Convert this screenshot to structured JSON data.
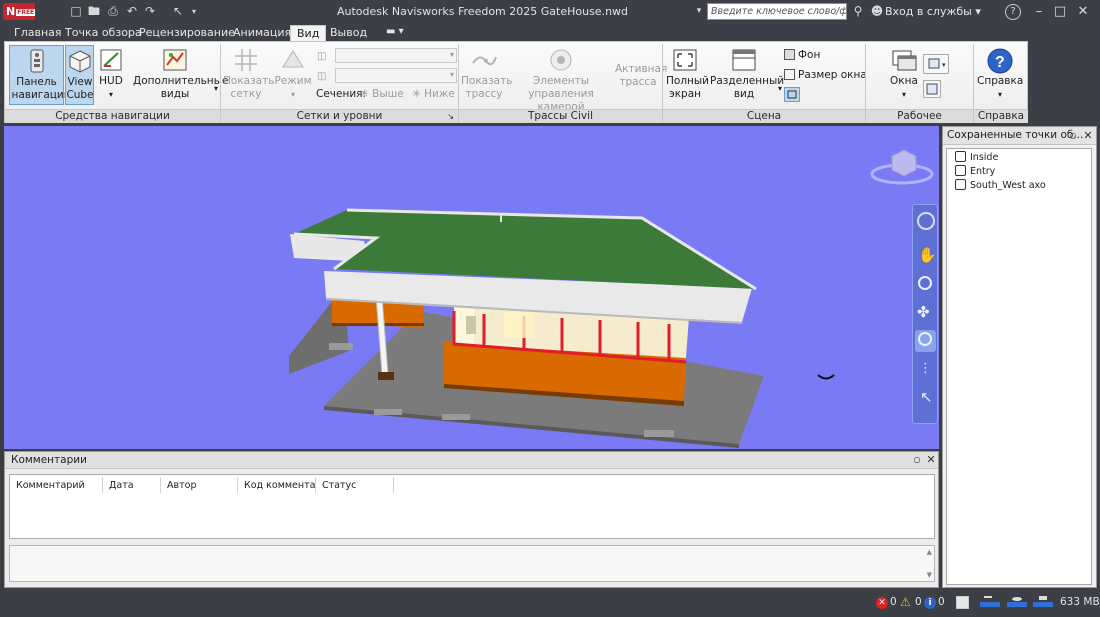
{
  "titlebar": {
    "logo_text": "N",
    "logo_badge": "FREE",
    "title": "Autodesk Navisworks Freedom 2025    GateHouse.nwd",
    "search_placeholder": "Введите ключевое слово/фразу",
    "signin": "Вход в службы",
    "icons": [
      "new-file-icon",
      "open-icon",
      "save-icon",
      "print-icon",
      "undo-icon",
      "redo-icon",
      "select-cursor-icon",
      "qat-dropdown-icon",
      "binoculars-icon",
      "user-icon",
      "help-icon",
      "minimize-icon",
      "maximize-icon",
      "close-icon"
    ]
  },
  "tabs": [
    {
      "label": "Главная",
      "active": false
    },
    {
      "label": "Точка обзора",
      "active": false
    },
    {
      "label": "Рецензирование",
      "active": false
    },
    {
      "label": "Анимация",
      "active": false
    },
    {
      "label": "Вид",
      "active": true
    },
    {
      "label": "Вывод",
      "active": false
    }
  ],
  "ribbon": {
    "nav_tools": {
      "title": "Средства навигации",
      "nav_panel": "Панель навигации",
      "view_cube": "View Cube",
      "hud": "HUD",
      "extra_views": "Дополнительные виды"
    },
    "grids": {
      "title": "Сетки и уровни",
      "show_grid": "Показать сетку",
      "mode": "Режим",
      "sections": "Сечения:",
      "above": "Выше",
      "below": "Ниже"
    },
    "civil": {
      "title": "Трассы Civil",
      "show_alignment": "Показать трассу",
      "camera_controls": "Элементы управления камерой",
      "active_alignment": "Активная трасса"
    },
    "scene": {
      "title": "Сцена",
      "full_screen": "Полный экран",
      "split_view": "Разделенный вид",
      "background": "Фон",
      "window_size": "Размер окна"
    },
    "workspace": {
      "title": "Рабочее пространство",
      "windows": "Окна"
    },
    "help": {
      "title": "Справка",
      "help": "Справка"
    }
  },
  "saved_viewpoints": {
    "title": "Сохраненные точки об...",
    "items": [
      "Inside",
      "Entry",
      "South_West axo"
    ]
  },
  "comments": {
    "title": "Комментарии",
    "columns": [
      "Комментарий",
      "Дата",
      "Автор",
      "Код коммента...",
      "Статус"
    ]
  },
  "statusbar": {
    "errors": "0",
    "warnings": "0",
    "infos": "0",
    "memory": "633 MB"
  },
  "colors": {
    "viewport_bg": "#7a7af5",
    "roof": "#3c7a3a",
    "wall_orange": "#d96a00",
    "window_red": "#e01d2a",
    "slab": "#7b7b7b",
    "chrome": "#3c3f45"
  }
}
